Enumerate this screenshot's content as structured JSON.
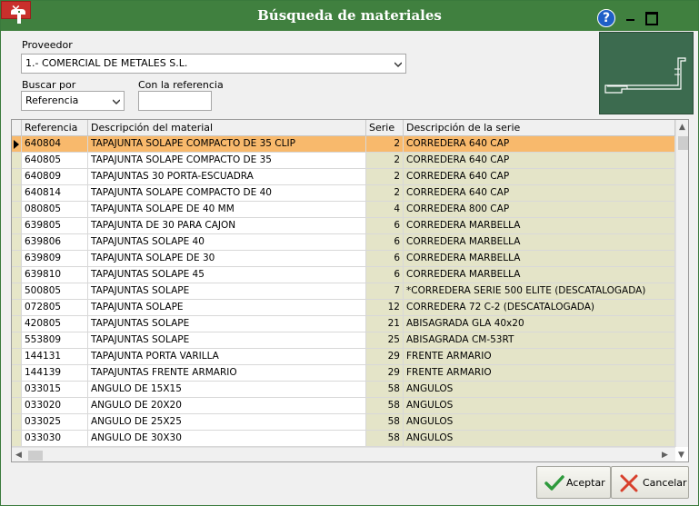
{
  "window": {
    "title": "Búsqueda de materiales",
    "help_label": "?",
    "close_label": "×"
  },
  "form": {
    "proveedor_label": "Proveedor",
    "proveedor_value": "1.- COMERCIAL DE METALES S.L.",
    "buscar_por_label": "Buscar por",
    "buscar_por_value": "Referencia",
    "con_referencia_label": "Con la referencia",
    "con_referencia_value": ""
  },
  "grid": {
    "columns": [
      "Referencia",
      "Descripción del material",
      "Serie",
      "Descripción de la serie"
    ],
    "rows": [
      {
        "ref": "640804",
        "desc": "TAPAJUNTA SOLAPE COMPACTO DE 35 CLIP",
        "serie": "2",
        "sdesc": "CORREDERA 640 CAP"
      },
      {
        "ref": "640805",
        "desc": "TAPAJUNTA SOLAPE COMPACTO DE 35",
        "serie": "2",
        "sdesc": "CORREDERA 640 CAP"
      },
      {
        "ref": "640809",
        "desc": "TAPAJUNTAS 30 PORTA-ESCUADRA",
        "serie": "2",
        "sdesc": "CORREDERA 640 CAP"
      },
      {
        "ref": "640814",
        "desc": "TAPAJUNTA SOLAPE COMPACTO DE 40",
        "serie": "2",
        "sdesc": "CORREDERA 640 CAP"
      },
      {
        "ref": "080805",
        "desc": "TAPAJUNTA SOLAPE DE 40 MM",
        "serie": "4",
        "sdesc": "CORREDERA 800 CAP"
      },
      {
        "ref": "639805",
        "desc": "TAPAJUNTA DE 30 PARA CAJON",
        "serie": "6",
        "sdesc": "CORREDERA MARBELLA"
      },
      {
        "ref": "639806",
        "desc": "TAPAJUNTAS SOLAPE 40",
        "serie": "6",
        "sdesc": "CORREDERA MARBELLA"
      },
      {
        "ref": "639809",
        "desc": "TAPAJUNTA SOLAPE DE 30",
        "serie": "6",
        "sdesc": "CORREDERA MARBELLA"
      },
      {
        "ref": "639810",
        "desc": "TAPAJUNTAS SOLAPE 45",
        "serie": "6",
        "sdesc": "CORREDERA MARBELLA"
      },
      {
        "ref": "500805",
        "desc": "TAPAJUNTAS SOLAPE",
        "serie": "7",
        "sdesc": "*CORREDERA SERIE 500 ELITE (DESCATALOGADA)"
      },
      {
        "ref": "072805",
        "desc": "TAPAJUNTA SOLAPE",
        "serie": "12",
        "sdesc": "CORREDERA 72 C-2 (DESCATALOGADA)"
      },
      {
        "ref": "420805",
        "desc": "TAPAJUNTAS SOLAPE",
        "serie": "21",
        "sdesc": "ABISAGRADA GLA 40x20"
      },
      {
        "ref": "553809",
        "desc": "TAPAJUNTAS SOLAPE",
        "serie": "25",
        "sdesc": "ABISAGRADA CM-53RT"
      },
      {
        "ref": "144131",
        "desc": "TAPAJUNTA PORTA VARILLA",
        "serie": "29",
        "sdesc": "FRENTE ARMARIO"
      },
      {
        "ref": "144139",
        "desc": "TAPAJUNTAS FRENTE ARMARIO",
        "serie": "29",
        "sdesc": "FRENTE ARMARIO"
      },
      {
        "ref": "033015",
        "desc": "ANGULO DE 15X15",
        "serie": "58",
        "sdesc": "ANGULOS"
      },
      {
        "ref": "033020",
        "desc": "ANGULO DE 20X20",
        "serie": "58",
        "sdesc": "ANGULOS"
      },
      {
        "ref": "033025",
        "desc": "ANGULO DE 25X25",
        "serie": "58",
        "sdesc": "ANGULOS"
      },
      {
        "ref": "033030",
        "desc": "ANGULO DE 30X30",
        "serie": "58",
        "sdesc": "ANGULOS"
      }
    ],
    "selected_index": 0
  },
  "buttons": {
    "accept_label": "Aceptar",
    "cancel_label": "Cancelar"
  },
  "colors": {
    "titlebar": "#40803f",
    "selected_row": "#f8b96c",
    "serie_column": "#e4e4c8"
  }
}
